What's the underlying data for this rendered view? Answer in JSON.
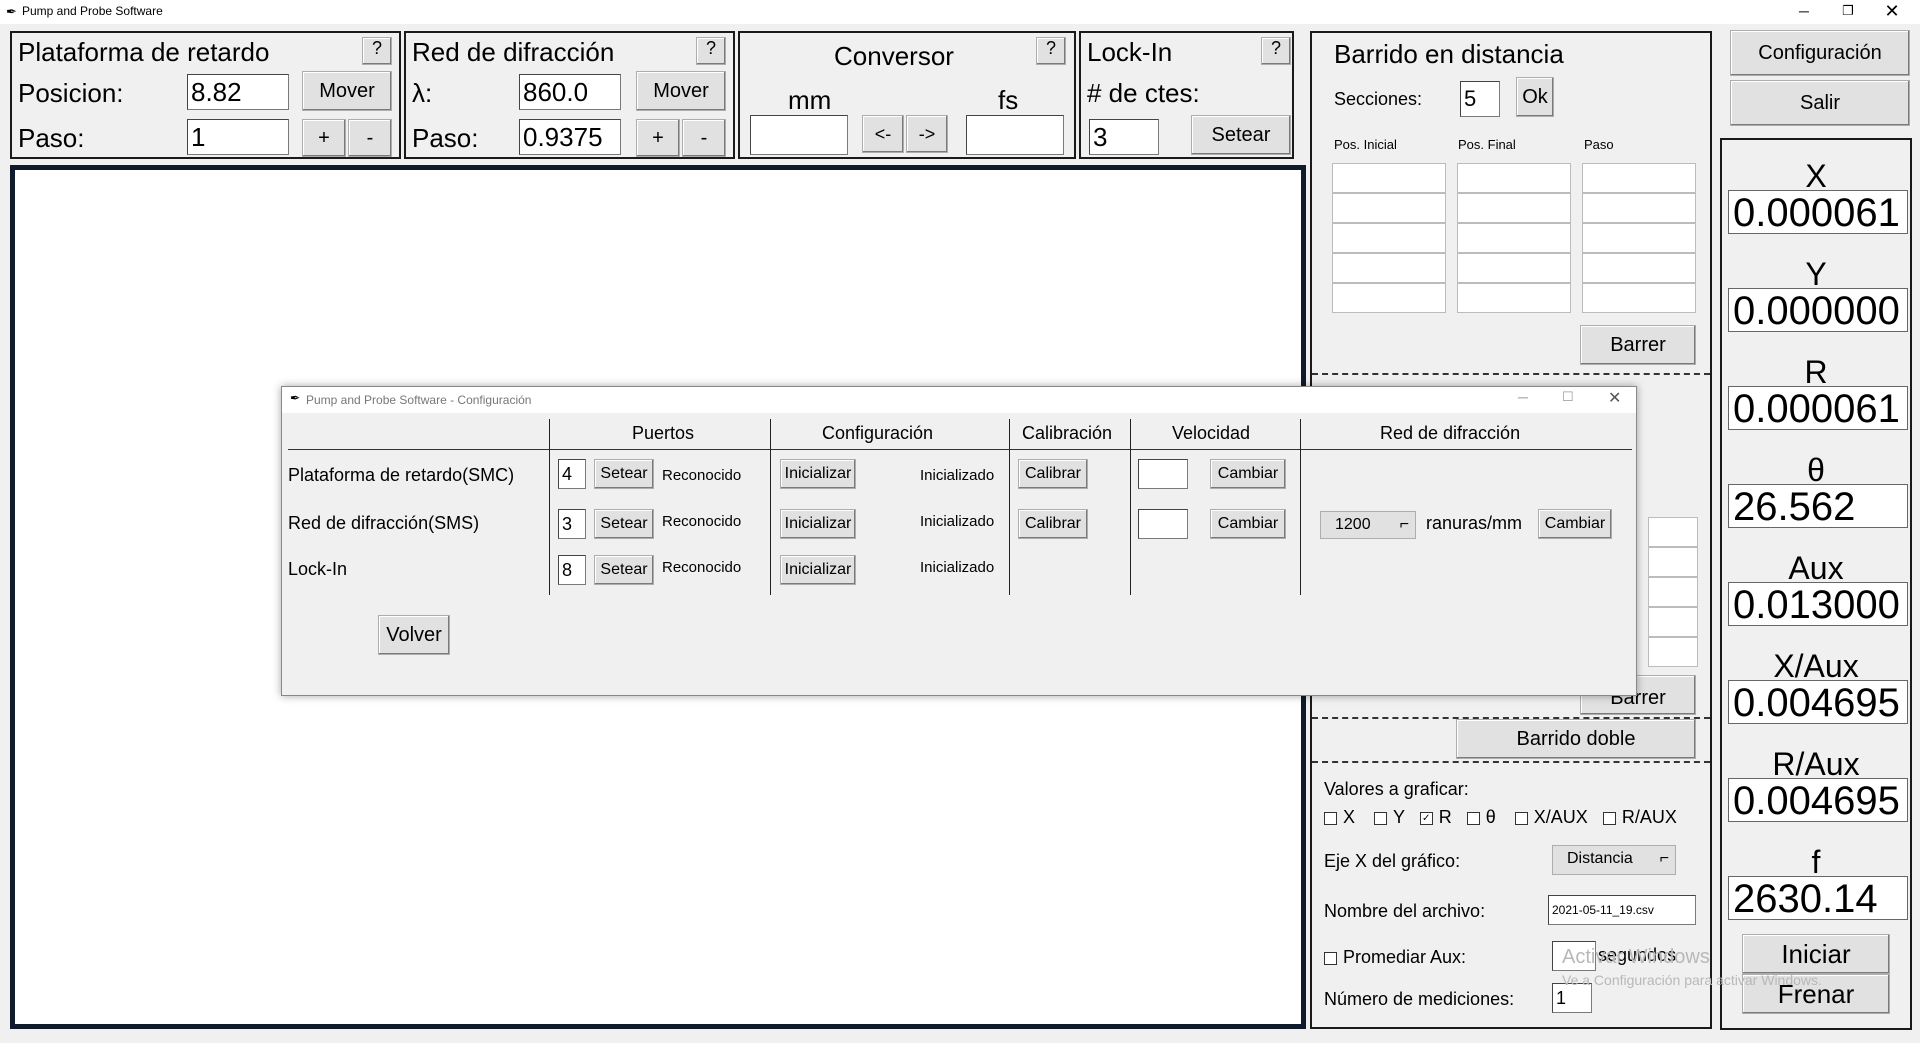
{
  "window": {
    "title": "Pump and Probe Software"
  },
  "delay_stage": {
    "title": "Plataforma de retardo",
    "help": "?",
    "position_label": "Posicion:",
    "position_value": "8.82",
    "move_label": "Mover",
    "step_label": "Paso:",
    "step_value": "1",
    "plus": "+",
    "minus": "-"
  },
  "grating": {
    "title": "Red de difracción",
    "help": "?",
    "lambda_label": "λ:",
    "lambda_value": "860.0",
    "move_label": "Mover",
    "step_label": "Paso:",
    "step_value": "0.9375",
    "plus": "+",
    "minus": "-"
  },
  "converter": {
    "title": "Conversor",
    "help": "?",
    "mm_label": "mm",
    "fs_label": "fs",
    "left_label": "<-",
    "right_label": "->",
    "mm_value": "",
    "fs_value": ""
  },
  "lockin": {
    "title": "Lock-In",
    "help": "?",
    "consts_label": "# de ctes:",
    "consts_value": "3",
    "set_label": "Setear"
  },
  "sweep": {
    "title": "Barrido en distancia",
    "sections_label": "Secciones:",
    "sections_value": "5",
    "ok_label": "Ok",
    "columns": [
      "Pos. Inicial",
      "Pos. Final",
      "Paso"
    ],
    "sweep_label": "Barrer",
    "double_sweep_label": "Barrido doble"
  },
  "lower": {
    "plot_values_label": "Valores a graficar:",
    "checks": [
      {
        "label": "X",
        "checked": false
      },
      {
        "label": "Y",
        "checked": false
      },
      {
        "label": "R",
        "checked": true
      },
      {
        "label": "θ",
        "checked": false
      },
      {
        "label": "X/AUX",
        "checked": false
      },
      {
        "label": "R/AUX",
        "checked": false
      }
    ],
    "xaxis_label": "Eje X del gráfico:",
    "xaxis_value": "Distancia",
    "filename_label": "Nombre del archivo:",
    "filename_value": "2021-05-11_19.csv",
    "avg_label": "Promediar Aux:",
    "seconds_label": "segundos",
    "measurements_label": "Número de mediciones:",
    "measurements_value": "1"
  },
  "right": {
    "config_label": "Configuración",
    "exit_label": "Salir",
    "readouts": [
      {
        "label": "X",
        "value": "0.000061"
      },
      {
        "label": "Y",
        "value": "0.000000"
      },
      {
        "label": "R",
        "value": "0.000061"
      },
      {
        "label": "θ",
        "value": "26.562"
      },
      {
        "label": "Aux",
        "value": "0.013000"
      },
      {
        "label": "X/Aux",
        "value": "0.004695"
      },
      {
        "label": "R/Aux",
        "value": "0.004695"
      },
      {
        "label": "f",
        "value": "2630.14"
      }
    ],
    "start_label": "Iniciar",
    "stop_label": "Frenar"
  },
  "watermark": {
    "line1": "Activar Windows",
    "line2": "Ve a Configuración para activar Windows."
  },
  "dialog": {
    "title": "Pump and Probe Software - Configuración",
    "headers": [
      "Puertos",
      "Configuración",
      "Calibración",
      "Velocidad",
      "Red de difracción"
    ],
    "rows": [
      {
        "name": "Plataforma de retardo(SMC)",
        "port": "4",
        "set": "Setear",
        "status": "Reconocido",
        "init": "Inicializar",
        "init_status": "Inicializado",
        "calibrate": "Calibrar",
        "speed": "",
        "change": "Cambiar"
      },
      {
        "name": "Red de difracción(SMS)",
        "port": "3",
        "set": "Setear",
        "status": "Reconocido",
        "init": "Inicializar",
        "init_status": "Inicializado",
        "calibrate": "Calibrar",
        "speed": "",
        "change": "Cambiar"
      },
      {
        "name": "Lock-In",
        "port": "8",
        "set": "Setear",
        "status": "Reconocido",
        "init": "Inicializar",
        "init_status": "Inicializado"
      }
    ],
    "grating_combo": "1200",
    "grating_units": "ranuras/mm",
    "grating_change": "Cambiar",
    "back_label": "Volver"
  },
  "partial_hidden": {
    "barrer": "Barrer"
  }
}
